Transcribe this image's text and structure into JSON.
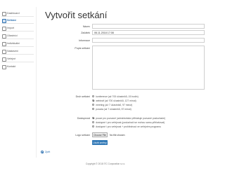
{
  "sidebar": {
    "items": [
      {
        "label": "Dashboard",
        "icon": "dashboard-icon",
        "active": false
      },
      {
        "label": "Setkání",
        "icon": "calendar-icon",
        "active": true
      },
      {
        "label": "Import",
        "icon": "import-icon",
        "active": false
      },
      {
        "label": "Účastníci",
        "icon": "users-icon",
        "active": false
      },
      {
        "label": "Individuální",
        "icon": "user-icon",
        "active": false
      },
      {
        "label": "Nastavení",
        "icon": "gear-icon",
        "active": false
      },
      {
        "label": "Veřejné",
        "icon": "globe-icon",
        "active": false
      },
      {
        "label": "Kontakt",
        "icon": "mail-icon",
        "active": false
      }
    ]
  },
  "main": {
    "title": "Vytvořit setkání",
    "fields": {
      "name_label": "Název",
      "name_value": "",
      "start_label": "Začátek",
      "start_value": "06.11.2018 17:08",
      "info_label": "Informace",
      "info_value": "",
      "desc_label": "Popis setkání"
    },
    "type": {
      "label": "Druh setkání",
      "options": [
        {
          "label": "konference (až 700 účastníků, 15 hodin)",
          "checked": false
        },
        {
          "label": "webinář (až 700 účastníků, 127 minut)",
          "checked": true
        },
        {
          "label": "meeting (až 7 účastníků, 97 minut)",
          "checked": false
        },
        {
          "label": "porada (až 7 účastníků, 57 minut)",
          "checked": false
        }
      ]
    },
    "access": {
      "label": "Dostupnost",
      "options": [
        {
          "label": "pouze pro pozvané (administrátor přihlašuje pozvané posluchače)",
          "checked": true
        },
        {
          "label": "dostupné i pro veřejnost (posluchači se mohou samo-přihlašovat)",
          "checked": false
        },
        {
          "label": "dostupné i pro veřejnost + prohlédnout ve veřejném programu",
          "checked": false
        }
      ]
    },
    "logo": {
      "label": "Logo setkání",
      "button": "Choose File",
      "status": "No file chosen"
    },
    "submit": "Uložit změny",
    "back": "Zpět"
  },
  "footer": "Copyright © 2018 ITC Corporation s.r.o.",
  "colors": {
    "accent": "#2a6fb0",
    "button": "#337ab7"
  }
}
